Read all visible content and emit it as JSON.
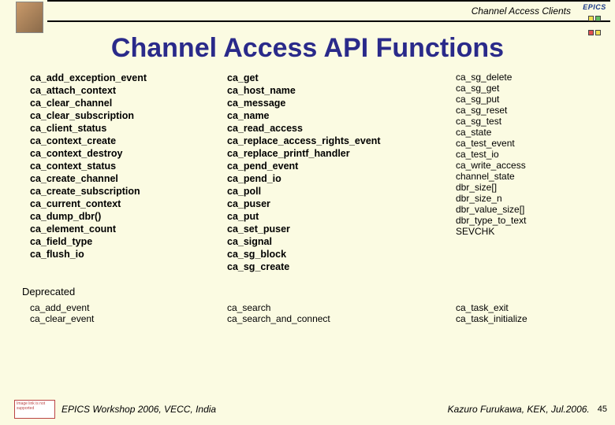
{
  "header": {
    "title": "Channel Access Clients",
    "epics_label": "EPICS"
  },
  "slide_title": "Channel Access API Functions",
  "functions": {
    "col1": [
      "ca_add_exception_event",
      "ca_attach_context",
      "ca_clear_channel",
      "ca_clear_subscription",
      "ca_client_status",
      "ca_context_create",
      "ca_context_destroy",
      "ca_context_status",
      "ca_create_channel",
      "ca_create_subscription",
      "ca_current_context",
      "ca_dump_dbr()",
      "ca_element_count",
      "ca_field_type",
      "ca_flush_io"
    ],
    "col2": [
      "ca_get",
      "ca_host_name",
      "ca_message",
      "ca_name",
      "ca_read_access",
      "ca_replace_access_rights_event",
      "ca_replace_printf_handler",
      "ca_pend_event",
      "ca_pend_io",
      "ca_poll",
      "ca_puser",
      "ca_put",
      "ca_set_puser",
      "ca_signal",
      "ca_sg_block",
      "ca_sg_create"
    ],
    "col3": [
      "ca_sg_delete",
      "ca_sg_get",
      "ca_sg_put",
      "ca_sg_reset",
      "ca_sg_test",
      "ca_state",
      "ca_test_event",
      "ca_test_io",
      "ca_write_access",
      "channel_state",
      "dbr_size[]",
      "dbr_size_n",
      "dbr_value_size[]",
      "dbr_type_to_text",
      "SEVCHK"
    ]
  },
  "deprecated": {
    "label": "Deprecated",
    "col1": [
      "ca_add_event",
      "ca_clear_event"
    ],
    "col2": [
      "ca_search",
      "ca_search_and_connect"
    ],
    "col3": [
      "ca_task_exit",
      "ca_task_initialize"
    ]
  },
  "footer": {
    "left": "EPICS Workshop 2006, VECC, India",
    "right": "Kazuro Furukawa, KEK, Jul.2006.",
    "page": "45"
  }
}
